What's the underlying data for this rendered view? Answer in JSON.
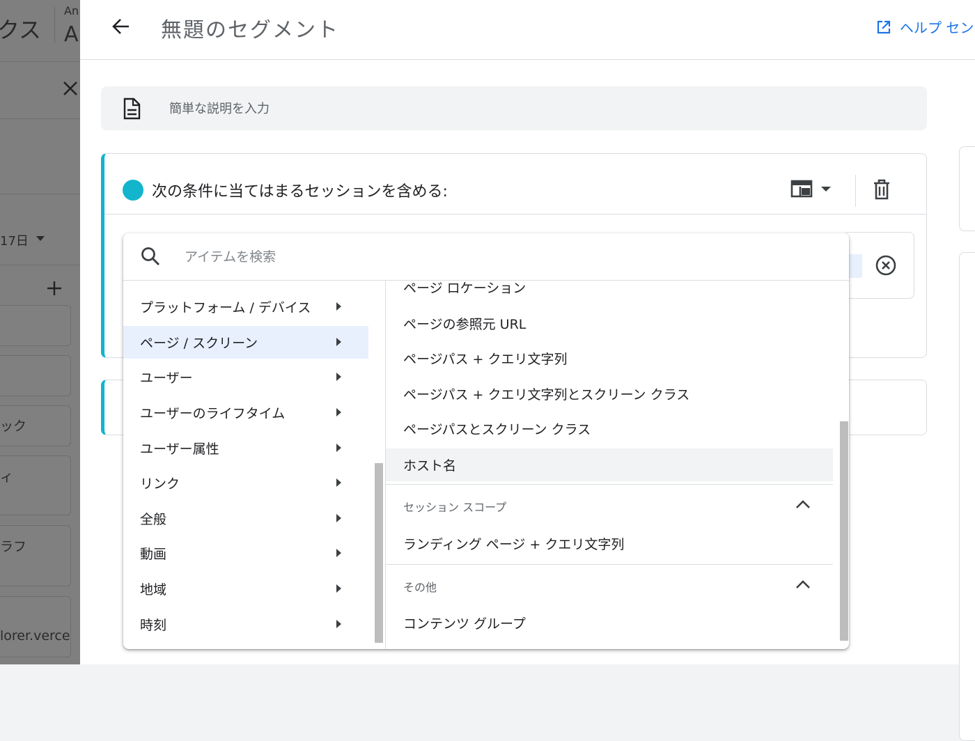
{
  "background_panel": {
    "title_fragment": "クス",
    "app_abbrev": "An",
    "app_letter": "A",
    "date": "17日",
    "items": [
      "ック",
      "ィ",
      "ラフ"
    ],
    "url_fragment": "lorer.verce"
  },
  "header": {
    "title": "無題のセグメント",
    "help_label": "ヘルプ セン"
  },
  "description": {
    "placeholder": "簡単な説明を入力"
  },
  "condition": {
    "title": "次の条件に当てはまるセッションを含める:",
    "accent_color": "#12b5cb"
  },
  "dropdown": {
    "search_placeholder": "アイテムを検索",
    "categories": [
      "プラットフォーム / デバイス",
      "ページ / スクリーン",
      "ユーザー",
      "ユーザーのライフタイム",
      "ユーザー属性",
      "リンク",
      "全般",
      "動画",
      "地域",
      "時刻"
    ],
    "selected_category": "ページ / スクリーン",
    "items": [
      "ページ ロケーション",
      "ページの参照元 URL",
      "ページパス + クエリ文字列",
      "ページパス + クエリ文字列とスクリーン クラス",
      "ページパスとスクリーン クラス",
      "ホスト名"
    ],
    "groups": [
      {
        "label": "セッション スコープ",
        "items": [
          "ランディング ページ + クエリ文字列"
        ]
      },
      {
        "label": "その他",
        "items": [
          "コンテンツ グループ"
        ]
      }
    ]
  }
}
